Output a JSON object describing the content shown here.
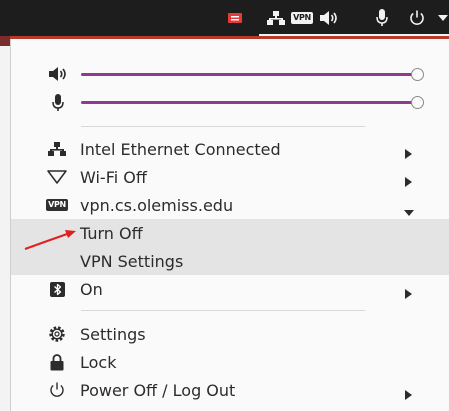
{
  "colors": {
    "topbar": "#1d1d1d",
    "slider_fill": "#8e3a8e",
    "highlight": "#e4e4e4",
    "annotation_arrow": "#e02020"
  },
  "topbar": {
    "icons": [
      "app-indicator-icon",
      "network-wired-icon",
      "vpn-icon",
      "volume-icon",
      "microphone-icon",
      "power-icon",
      "chevron-down-icon"
    ],
    "vpn_badge": "VPN"
  },
  "sliders": [
    {
      "name": "volume",
      "icon": "volume-icon",
      "level": 1.0
    },
    {
      "name": "microphone",
      "icon": "microphone-icon",
      "level": 1.0
    }
  ],
  "menu": {
    "network": [
      {
        "label": "Intel Ethernet Connected",
        "icon": "network-wired-icon",
        "submenu": "collapsed"
      },
      {
        "label": "Wi-Fi Off",
        "icon": "wifi-off-icon",
        "submenu": "collapsed"
      },
      {
        "label": "vpn.cs.olemiss.edu",
        "icon": "vpn-icon",
        "submenu": "expanded",
        "badge": "VPN"
      }
    ],
    "vpn_submenu": [
      {
        "label": "Turn Off",
        "highlighted": true
      },
      {
        "label": "VPN Settings"
      }
    ],
    "bluetooth": {
      "label": "On",
      "icon": "bluetooth-icon",
      "submenu": "collapsed"
    },
    "system": [
      {
        "label": "Settings",
        "icon": "settings-icon"
      },
      {
        "label": "Lock",
        "icon": "lock-icon"
      },
      {
        "label": "Power Off / Log Out",
        "icon": "power-icon",
        "submenu": "collapsed"
      }
    ]
  }
}
